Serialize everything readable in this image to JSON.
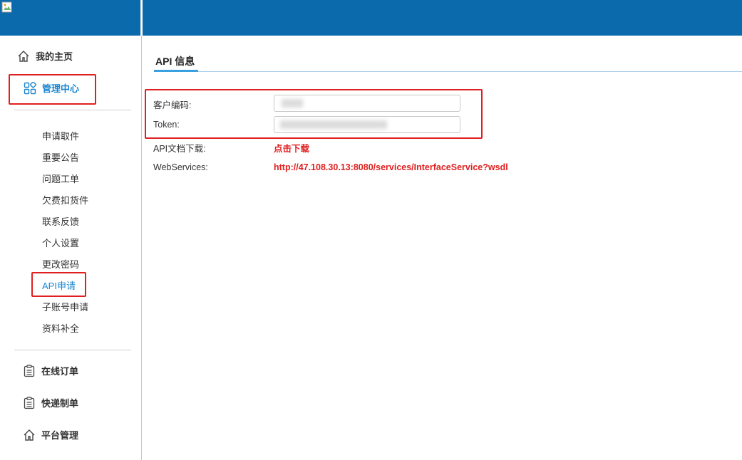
{
  "sidebar": {
    "home": {
      "label": "我的主页",
      "icon": "home-icon"
    },
    "manage": {
      "label": "管理中心",
      "icon": "grid-icon"
    },
    "sub_items": [
      {
        "label": "申请取件"
      },
      {
        "label": "重要公告"
      },
      {
        "label": "问题工单"
      },
      {
        "label": "欠费扣货件"
      },
      {
        "label": "联系反馈"
      },
      {
        "label": "个人设置"
      },
      {
        "label": "更改密码"
      },
      {
        "label": "API申请"
      },
      {
        "label": "子账号申请"
      },
      {
        "label": "资料补全"
      }
    ],
    "online_order": {
      "label": "在线订单",
      "icon": "clipboard-icon"
    },
    "express": {
      "label": "快递制单",
      "icon": "clipboard-icon"
    },
    "platform": {
      "label": "平台管理",
      "icon": "home-icon"
    }
  },
  "main": {
    "tab_title": "API 信息",
    "fields": {
      "customer_code_label": "客户编码:",
      "token_label": "Token:",
      "api_doc_label": "API文档下载:",
      "api_doc_link": "点击下载",
      "webservices_label": "WebServices:",
      "webservices_url": "http://47.108.30.13:8080/services/InterfaceService?wsdl"
    }
  },
  "colors": {
    "header_blue": "#0a6aac",
    "accent_blue": "#1e86cf",
    "highlight_red": "#e02020"
  }
}
